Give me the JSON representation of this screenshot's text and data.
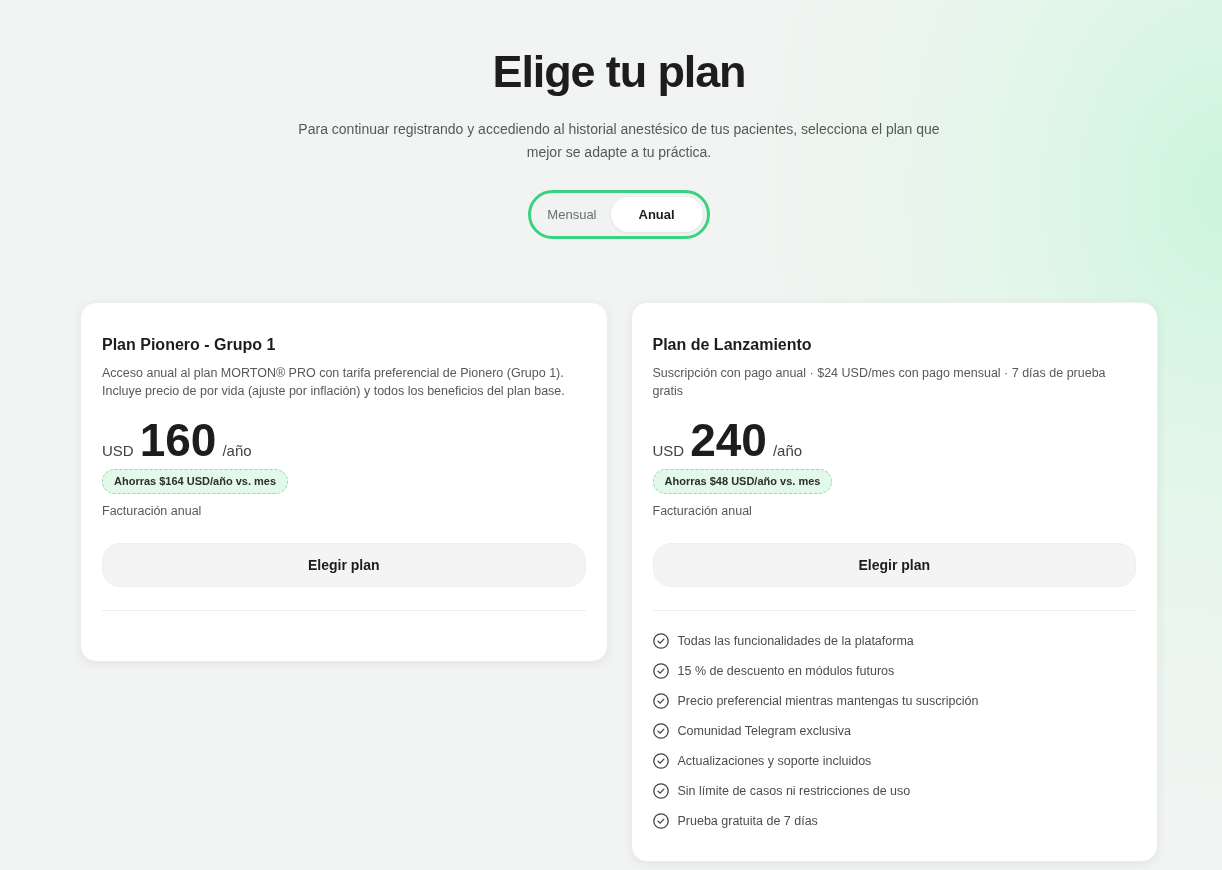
{
  "heading": {
    "title": "Elige tu plan",
    "subtitle": "Para continuar registrando y accediendo al historial anestésico de tus pacientes, selecciona el plan que mejor se adapte a tu práctica."
  },
  "billing_toggle": [
    {
      "label": "Mensual",
      "selected": false
    },
    {
      "label": "Anual",
      "selected": true
    }
  ],
  "plans": [
    {
      "name": "Plan Pionero - Grupo 1",
      "description": "Acceso anual al plan MORTON® PRO con tarifa preferencial de Pionero (Grupo 1). Incluye precio de por vida (ajuste por inflación) y todos los beneficios del plan base.",
      "currency": "USD",
      "price": "160",
      "period": "/año",
      "savings_badge": "Ahorras $164 USD/año vs. mes",
      "billing_note": "Facturación anual",
      "button": "Elegir plan"
    },
    {
      "name": "Plan de Lanzamiento",
      "description": "Suscripción con pago anual · $24 USD/mes con pago mensual · 7 días de prueba gratis",
      "currency": "USD",
      "price": "240",
      "period": "/año",
      "savings_badge": "Ahorras $48 USD/año vs. mes",
      "billing_note": "Facturación anual",
      "button": "Elegir plan",
      "features": [
        "Todas las funcionalidades de la plataforma",
        "15 % de descuento en módulos futuros",
        "Precio preferencial mientras mantengas tu suscripción",
        "Comunidad Telegram exclusiva",
        "Actualizaciones y soporte incluidos",
        "Sin límite de casos ni restricciones de uso",
        "Prueba gratuita de 7 días"
      ]
    }
  ]
}
